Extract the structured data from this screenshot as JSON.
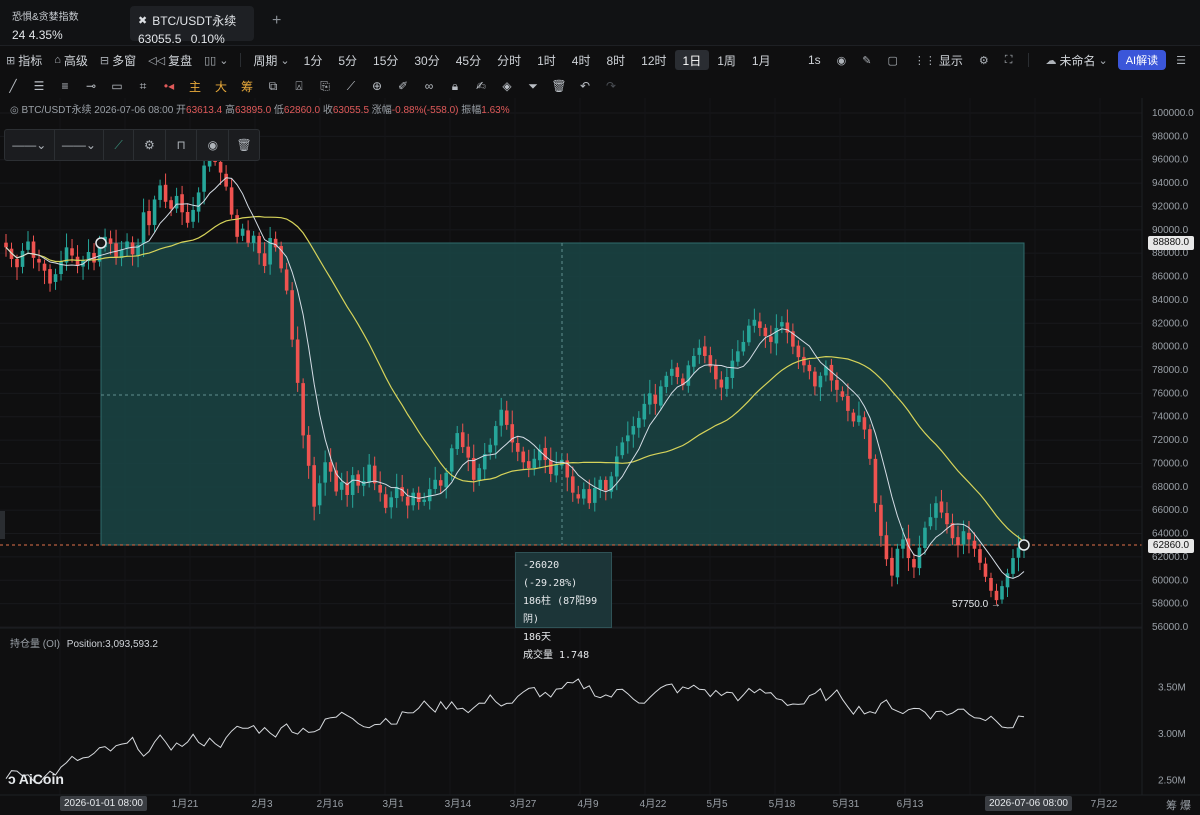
{
  "top": {
    "fear_greed_title": "恐惧&贪婪指数",
    "fear_greed_value": "24",
    "fear_greed_change": "4.35%",
    "tab_symbol": "BTC/USDT永续",
    "tab_price": "63055.5",
    "tab_change": "0.10%",
    "add_tab": "+"
  },
  "toolbar1": {
    "indicators": "指标",
    "advanced": "高级",
    "multi_window": "多窗",
    "replay": "复盘",
    "period_label": "周期",
    "periods": [
      "1分",
      "5分",
      "15分",
      "30分",
      "45分",
      "分时",
      "1时",
      "4时",
      "8时",
      "12时",
      "1日",
      "1周",
      "1月"
    ],
    "active_period": "1日",
    "interval": "1s",
    "display": "显示",
    "unnamed": "未命名",
    "ai": "AI解读"
  },
  "toolbar2": {
    "main": "主",
    "big": "大",
    "chips": "筹"
  },
  "legend": {
    "symbol": "BTC/USDT永续",
    "time": "2026-07-06 08:00",
    "open_label": "开",
    "open": "63613.4",
    "high_label": "高",
    "high": "63895.0",
    "low_label": "低",
    "low": "62860.0",
    "close_label": "收",
    "close": "63055.5",
    "change_label": "涨幅",
    "change": "-0.88%(-558.0)",
    "amp_label": "振幅",
    "amp": "1.63%"
  },
  "measure": {
    "diff": "-26020 (-29.28%)",
    "bars": "186柱 (87阳99阴)",
    "days": "186天",
    "volume": "成交量 1.748"
  },
  "oi": {
    "label": "持仓量 (OI)",
    "position": "Position:3,093,593.2"
  },
  "logo": "AiCoin",
  "price_axis": [
    "100000.0",
    "98000.0",
    "96000.0",
    "94000.0",
    "92000.0",
    "90000.0",
    "88000.0",
    "86000.0",
    "84000.0",
    "82000.0",
    "80000.0",
    "78000.0",
    "76000.0",
    "74000.0",
    "72000.0",
    "70000.0",
    "68000.0",
    "66000.0",
    "64000.0",
    "62000.0",
    "60000.0",
    "58000.0",
    "56000.0"
  ],
  "price_tags": {
    "top": "88880.0",
    "current": "62860.0"
  },
  "low_label": "57750.0 →",
  "oi_axis": [
    "3.50M",
    "3.00M",
    "2.50M"
  ],
  "date_axis": [
    "1月21",
    "2月3",
    "2月16",
    "3月1",
    "3月14",
    "3月27",
    "4月9",
    "4月22",
    "5月5",
    "5月18",
    "5月31",
    "6月13",
    "7月22"
  ],
  "date_tags": {
    "start": "2026-01-01 08:00",
    "end": "2026-07-06 08:00"
  },
  "colors": {
    "up": "#26a69a",
    "down": "#ef5350",
    "box": "#1c4a4a",
    "ma_fast": "#d5dde6",
    "ma_slow": "#d6d35a"
  },
  "chart_data": {
    "type": "candlestick",
    "symbol": "BTC/USDT永续",
    "interval": "1日",
    "ylim": [
      56000,
      100000
    ],
    "closes": [
      88500,
      87500,
      86800,
      88200,
      89000,
      87600,
      87200,
      86500,
      85400,
      86200,
      87300,
      88500,
      87800,
      86900,
      87400,
      88100,
      87200,
      88600,
      89400,
      88800,
      87600,
      88300,
      89000,
      87900,
      88700,
      91500,
      90400,
      92600,
      93800,
      92400,
      91800,
      92900,
      91500,
      90600,
      91700,
      93200,
      95500,
      96400,
      95800,
      94900,
      93700,
      91300,
      89400,
      90100,
      88900,
      89500,
      88000,
      86900,
      89300,
      88500,
      86700,
      84800,
      80600,
      76900,
      72400,
      69800,
      66300,
      68300,
      70100,
      69300,
      67600,
      68400,
      67300,
      69000,
      68100,
      68500,
      69900,
      68300,
      67500,
      66200,
      67100,
      68000,
      67200,
      66400,
      67500,
      66700,
      66900,
      67800,
      68600,
      68100,
      69200,
      71300,
      72600,
      71400,
      70500,
      68600,
      69600,
      70800,
      71600,
      73200,
      74600,
      73300,
      71800,
      71000,
      70100,
      69600,
      70400,
      71200,
      70300,
      69100,
      69900,
      70300,
      68800,
      67500,
      67000,
      67800,
      66600,
      67900,
      68600,
      67700,
      68900,
      70600,
      71800,
      72400,
      73200,
      73900,
      75100,
      76000,
      75100,
      76600,
      77500,
      78100,
      77400,
      76700,
      78400,
      79200,
      79900,
      79200,
      78300,
      77200,
      76500,
      77400,
      78800,
      79600,
      80400,
      81800,
      82300,
      81600,
      80900,
      80400,
      81600,
      82100,
      81200,
      80000,
      79100,
      78400,
      77900,
      76600,
      77500,
      78300,
      77100,
      76300,
      75700,
      74500,
      73600,
      74100,
      72900,
      70400,
      66600,
      63800,
      61800,
      60400,
      62700,
      63500,
      61900,
      61100,
      62800,
      64500,
      65400,
      66600,
      65800,
      64800,
      63600,
      63000,
      64200,
      63500,
      62700,
      61500,
      60300,
      59100,
      58300,
      59500,
      60600,
      61900,
      62800,
      63056
    ]
  }
}
